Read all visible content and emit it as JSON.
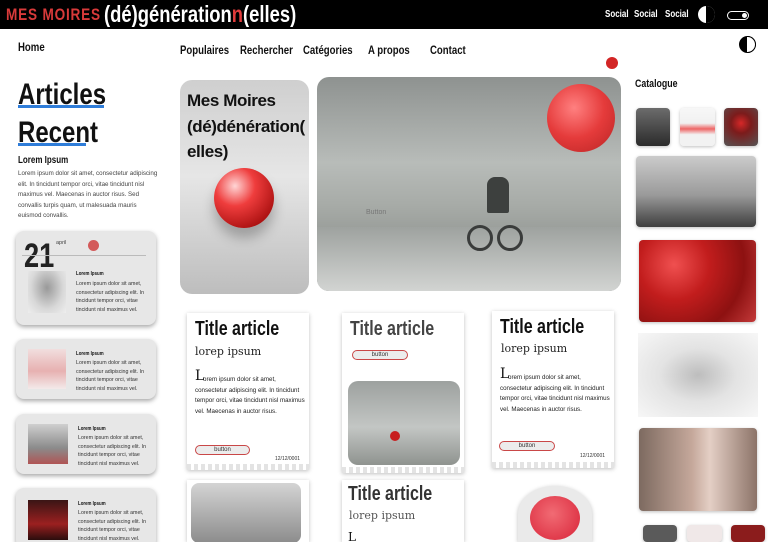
{
  "header": {
    "logo_text": "MES MOIRES",
    "brand_prefix": "(dé)génération",
    "brand_red": "n",
    "brand_suffix": "(elles)",
    "social_links": [
      "Social",
      "Social",
      "Social"
    ]
  },
  "sidebar": {
    "home": "Home",
    "title_line1": "Articles",
    "title_line2": "Recent",
    "intro_title": "Lorem Ipsum",
    "intro_text": "Lorem ipsum dolor sit amet, consectetur adipiscing elit. In tincidunt tempor orci, vitae tincidunt nisl maximus vel. Maecenas in auctor risus. Sed convallis turpis quam, ut malesuada mauris euismod convallis.",
    "featured": {
      "day": "21",
      "month": "april"
    },
    "cards": [
      {
        "title": "Lorem Ipsum",
        "text": "Lorem ipsum dolor sit amet, consectetur adipiscing elit. In tincidunt tempor orci, vitae tincidunt nisl maximus vel."
      },
      {
        "title": "Lorem Ipsum",
        "text": "Lorem ipsum dolor sit amet, consectetur adipiscing elit. In tincidunt tempor orci, vitae tincidunt nisl maximus vel."
      },
      {
        "title": "Lorem Ipsum",
        "text": "Lorem ipsum dolor sit amet, consectetur adipiscing elit. In tincidunt tempor orci, vitae tincidunt nisl maximus vel."
      },
      {
        "title": "Lorem Ipsum",
        "text": "Lorem ipsum dolor sit amet, consectetur adipiscing elit. In tincidunt tempor orci, vitae tincidunt nisl maximus vel."
      }
    ]
  },
  "nav": {
    "items": [
      "Populaires",
      "Rechercher",
      "Catégories",
      "A propos",
      "Contact"
    ]
  },
  "hero": {
    "title": "Mes Moires (dé)dénération( elles)",
    "image_text": "Button"
  },
  "articles": [
    {
      "title": "Title article",
      "subtitle": "lorep ipsum",
      "dropcap": "L",
      "body": "orem ipsum dolor sit amet, consectetur adipiscing elit. In tincidunt tempor orci, vitae tincidunt nisl maximus vel. Maecenas in auctor risus.",
      "button": "button",
      "date": "12/12/0001"
    },
    {
      "title": "Title article",
      "button": "button"
    },
    {
      "title": "Title article",
      "subtitle": "lorep ipsum",
      "dropcap": "L",
      "body": "orem ipsum dolor sit amet, consectetur adipiscing elit. In tincidunt tempor orci, vitae tincidunt nisl maximus vel. Maecenas in auctor risus.",
      "button": "button",
      "date": "12/12/0001"
    },
    {
      "title": "Title article",
      "subtitle": "lorep ipsum",
      "dropcap": "L"
    }
  ],
  "catalogue": {
    "title": "Catalogue"
  },
  "colors": {
    "accent_red": "#d32525",
    "underline_blue": "#2f7dd9",
    "header_bg": "#000000"
  }
}
